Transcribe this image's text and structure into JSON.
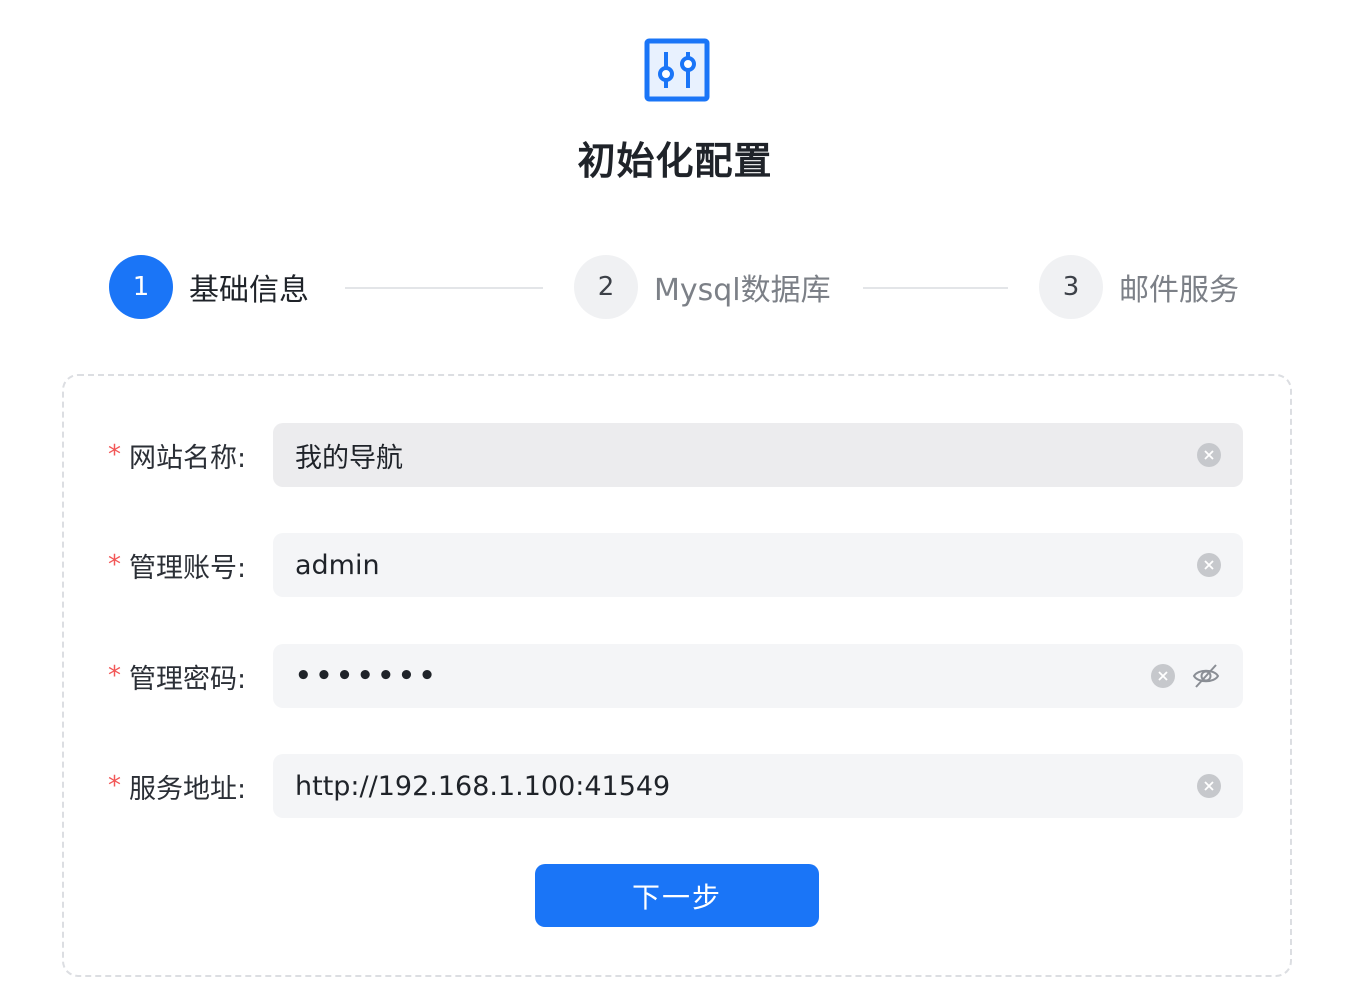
{
  "header": {
    "logo_icon": "sliders-icon",
    "title": "初始化配置"
  },
  "steps": [
    {
      "number": "1",
      "label": "基础信息",
      "state": "active"
    },
    {
      "number": "2",
      "label": "Mysql数据库",
      "state": "inactive"
    },
    {
      "number": "3",
      "label": "邮件服务",
      "state": "inactive"
    }
  ],
  "form": {
    "required_mark": "*",
    "fields": [
      {
        "label": "网站名称:",
        "value": "我的导航",
        "icon": "clear-icon"
      },
      {
        "label": "管理账号:",
        "value": "admin",
        "icon": "clear-icon"
      },
      {
        "label": "管理密码:",
        "value": "•••••••",
        "icon": "clear-icon",
        "extra_icon": "eye-off-icon"
      },
      {
        "label": "服务地址:",
        "value": "http://192.168.1.100:41549",
        "icon": "clear-icon"
      }
    ],
    "next_label": "下一步"
  },
  "colors": {
    "primary": "#1a75f7",
    "required": "#f25757",
    "input_bg": "#f4f5f7"
  }
}
